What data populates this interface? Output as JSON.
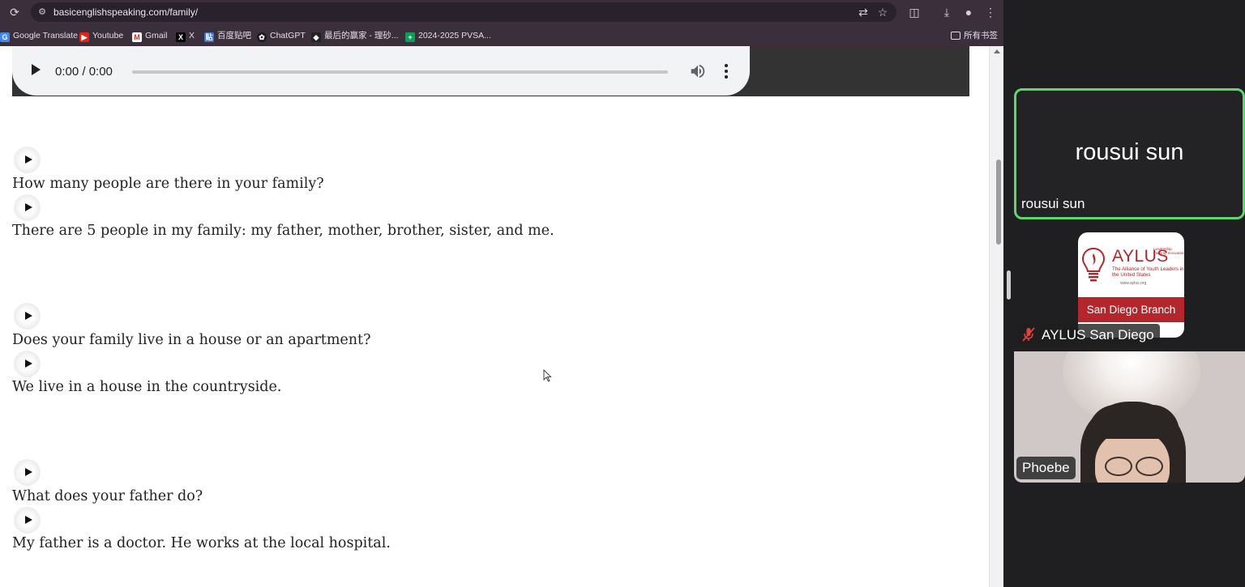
{
  "browser": {
    "url": "basicenglishspeaking.com/family/",
    "bookmarks": [
      {
        "label": "Google Translate",
        "icon": "google-translate-icon"
      },
      {
        "label": "Youtube",
        "icon": "youtube-icon"
      },
      {
        "label": "Gmail",
        "icon": "gmail-icon"
      },
      {
        "label": "X",
        "icon": "x-icon"
      },
      {
        "label": "百度贴吧",
        "icon": "baidu-tieba-icon"
      },
      {
        "label": "ChatGPT",
        "icon": "chatgpt-icon"
      },
      {
        "label": "最后的赢家 - 理砂...",
        "icon": "site-icon"
      },
      {
        "label": "2024-2025 PVSA...",
        "icon": "sheets-icon"
      }
    ],
    "all_bookmarks_label": "所有书签"
  },
  "page": {
    "audio_player": {
      "time": "0:00 / 0:00"
    },
    "qa": [
      {
        "text": "How many people are there in your family?"
      },
      {
        "text": "There are 5 people in my family: my father, mother, brother, sister, and me."
      },
      {
        "text": "Does your family live in a house or an apartment?"
      },
      {
        "text": "We live in a house in the countryside."
      },
      {
        "text": "What does your father do?"
      },
      {
        "text": "My father is a doctor. He works at the local hospital."
      }
    ]
  },
  "meeting": {
    "participants": [
      {
        "display_name": "rousui sun",
        "name_tag": "rousui sun",
        "active_speaker": true,
        "border_color": "#5ed66c"
      },
      {
        "name_tag": "AYLUS San Diego",
        "muted": true,
        "logo": {
          "brand": "AYLUS",
          "tagline": "Leadership Integrity Innovation",
          "subtitle": "The Alliance of Youth Leaders in the United States",
          "website": "www.aylus.org",
          "branch": "San Diego Branch"
        }
      },
      {
        "name_tag": "Phoebe",
        "video": true
      }
    ]
  },
  "colors": {
    "toolbar_bg": "#3b2f3c",
    "meeting_bg": "#1f1f21",
    "aylus_red": "#b3262b"
  }
}
